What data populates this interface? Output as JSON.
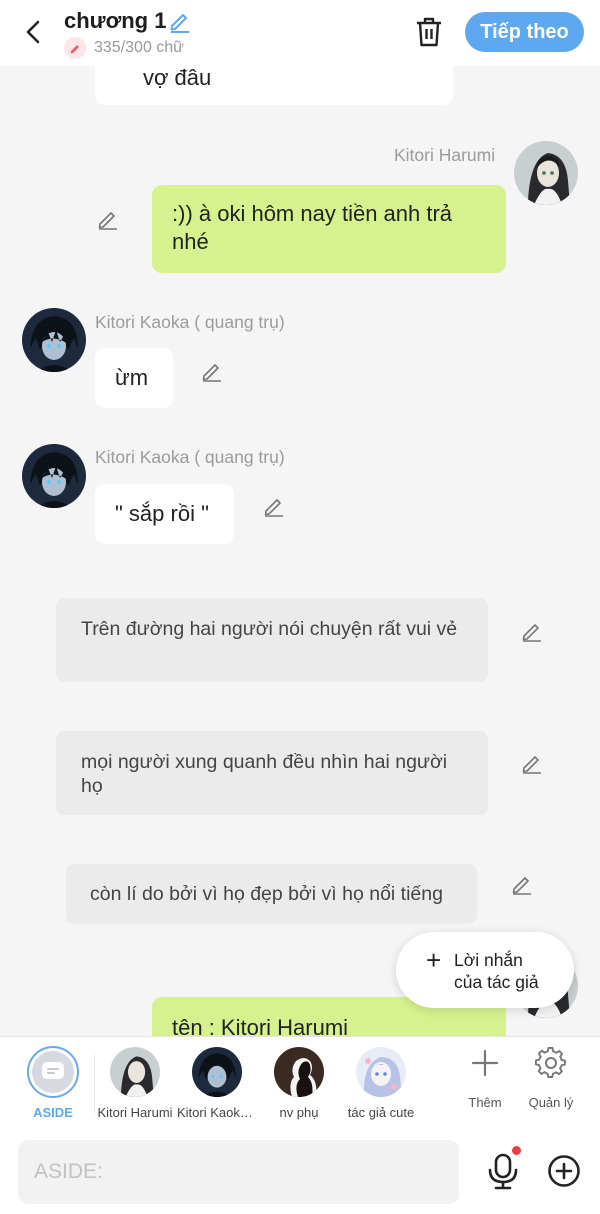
{
  "header": {
    "title": "chương 1",
    "word_count": "335/300 chữ",
    "next_label": "Tiếp theo"
  },
  "colors": {
    "accent": "#5ea8ef",
    "green_bubble": "#d6f28e",
    "aside_bubble": "#ebebeb",
    "count_icon": "#ef5a6f"
  },
  "messages": [
    {
      "type": "left",
      "text": "vợ đâu"
    },
    {
      "type": "right",
      "name": "Kitori Harumi",
      "text": ":)) à oki hôm nay tiền anh trả nhé"
    },
    {
      "type": "left",
      "name": "Kitori Kaoka ( quang trụ)",
      "text": "ừm"
    },
    {
      "type": "left",
      "name": "Kitori Kaoka ( quang trụ)",
      "text": "\" sắp rồi \""
    },
    {
      "type": "aside",
      "text": "Trên đường hai người nói chuyện rất vui vẻ"
    },
    {
      "type": "aside",
      "text": "mọi người xung quanh đều nhìn hai người họ"
    },
    {
      "type": "aside",
      "text": "còn lí do bởi vì họ đẹp bởi vì họ nổi tiếng"
    },
    {
      "type": "right",
      "text": "tên : Kitori Harumi"
    }
  ],
  "popup": {
    "line1": "Lời nhắn",
    "line2": "của tác giả"
  },
  "characters": [
    {
      "label": "ASIDE",
      "icon": "message-icon",
      "selected": true
    },
    {
      "label": "Kitori Harumi",
      "icon": "avatar-harumi"
    },
    {
      "label": "Kitori Kaoka ( quang trụ)",
      "icon": "avatar-kaoka"
    },
    {
      "label": "nv phụ",
      "icon": "avatar-silhouette"
    },
    {
      "label": "tác giả cute",
      "icon": "avatar-author"
    }
  ],
  "tools": [
    {
      "label": "Thêm",
      "icon": "plus-icon"
    },
    {
      "label": "Quản lý",
      "icon": "gear-icon"
    }
  ],
  "input": {
    "placeholder": "ASIDE:"
  }
}
